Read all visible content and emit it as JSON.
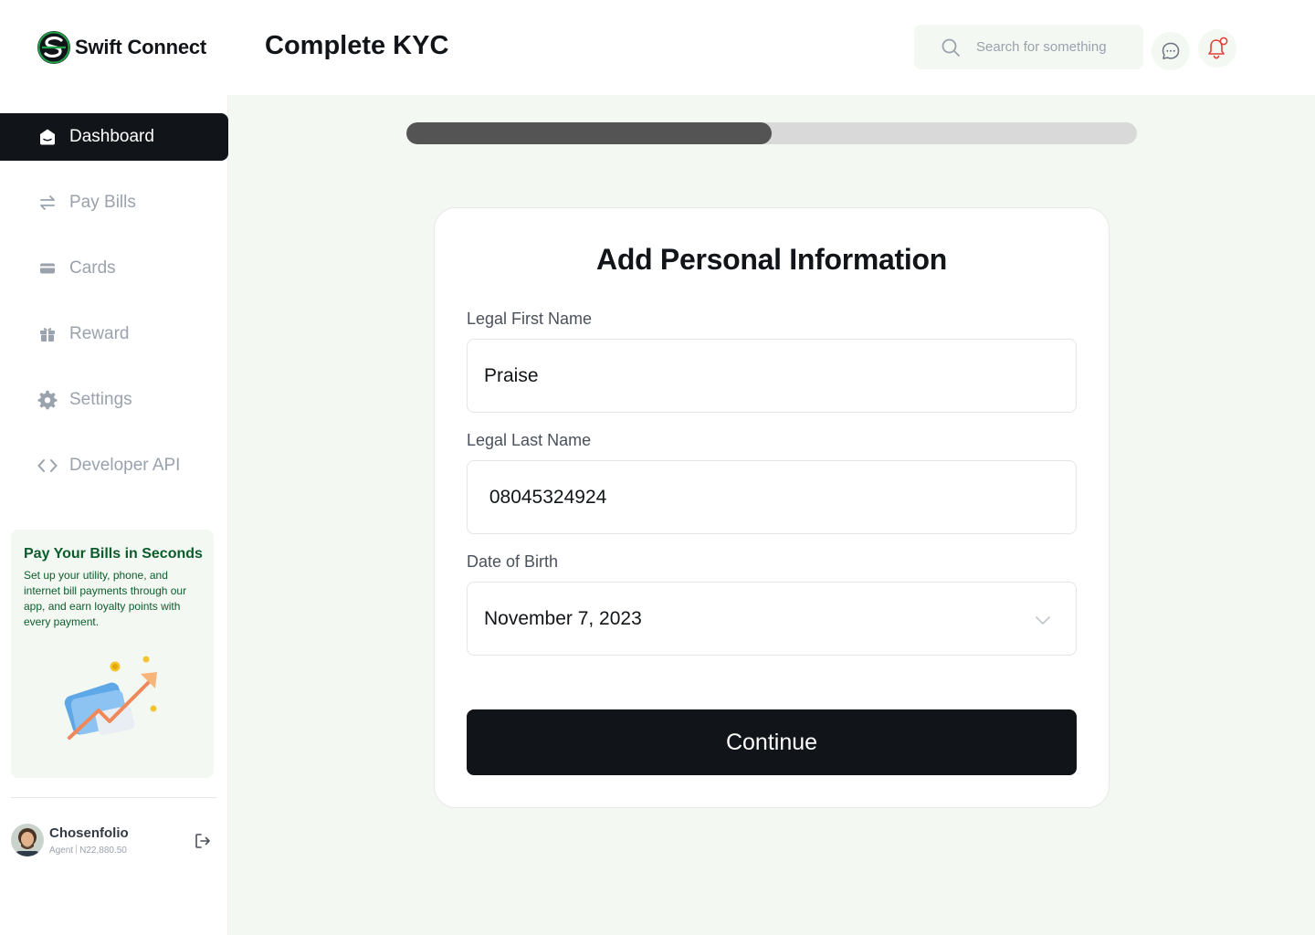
{
  "app": {
    "brand": "Swift Connect",
    "page_title": "Complete KYC"
  },
  "header": {
    "search_placeholder": "Search for something",
    "search_value": ""
  },
  "sidebar": {
    "items": [
      {
        "label": "Dashboard",
        "icon": "home-icon",
        "active": true
      },
      {
        "label": "Pay Bills",
        "icon": "transfer-icon",
        "active": false
      },
      {
        "label": "Cards",
        "icon": "card-icon",
        "active": false
      },
      {
        "label": "Reward",
        "icon": "gift-icon",
        "active": false
      },
      {
        "label": "Settings",
        "icon": "gear-icon",
        "active": false
      },
      {
        "label": "Developer API",
        "icon": "code-icon",
        "active": false
      }
    ],
    "promo": {
      "title": "Pay Your Bills in Seconds",
      "text": "Set up your utility, phone, and internet bill payments through our app, and earn loyalty points with every payment."
    },
    "user": {
      "name": "Chosenfolio",
      "role": "Agent",
      "balance": "N22,880.50"
    }
  },
  "kyc": {
    "progress_fraction": 0.5,
    "card_title": "Add Personal Information",
    "first_name_label": "Legal First Name",
    "first_name_value": "Praise",
    "last_name_label": "Legal Last Name",
    "last_name_value": " 08045324924",
    "dob_label": "Date of Birth",
    "dob_value": "November 7, 2023",
    "continue_label": "Continue"
  },
  "colors": {
    "active_nav_bg": "#111418",
    "main_bg": "#f4f8f2",
    "progress_fill": "#545454",
    "progress_track": "#d9d9d9",
    "promo_text": "#0b5c2c",
    "brand_green": "#1fa34a",
    "notification_red": "#e0433b"
  }
}
